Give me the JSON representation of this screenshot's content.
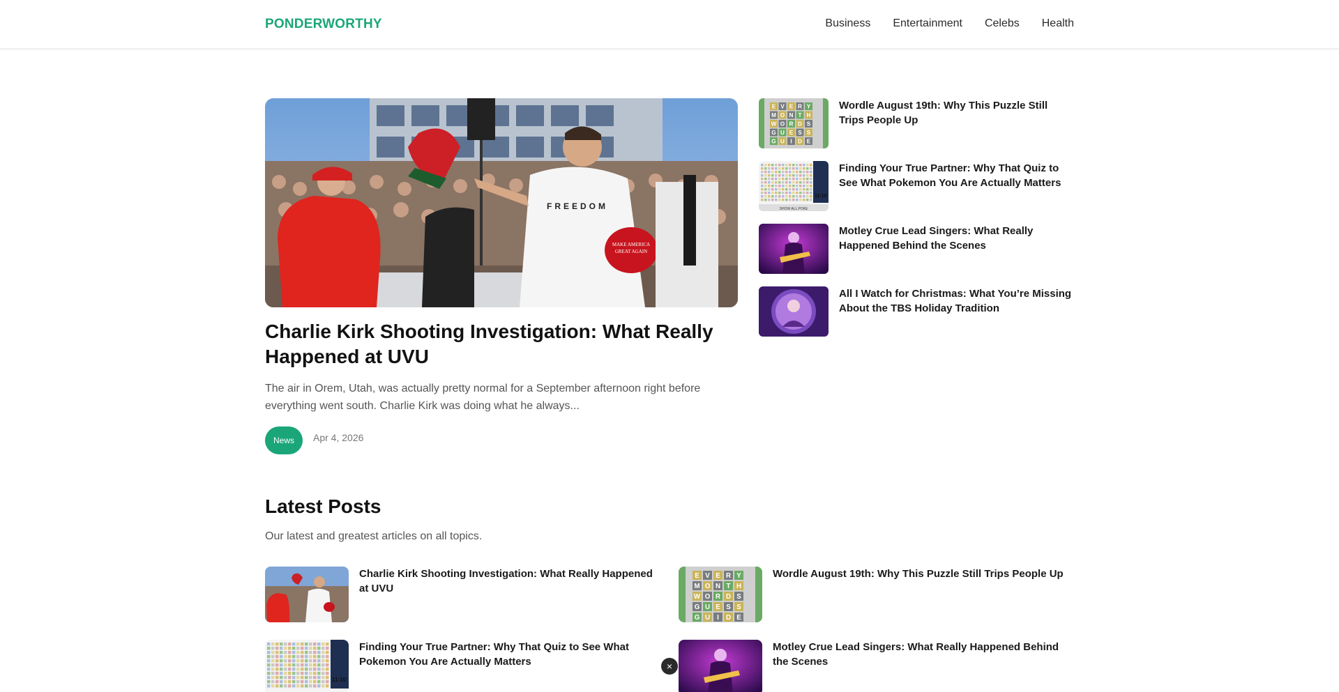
{
  "site": {
    "logo": "PONDERWORTHY",
    "accent": "#1aa679"
  },
  "nav": {
    "items": [
      "Business",
      "Entertainment",
      "Celebs",
      "Health"
    ]
  },
  "hero": {
    "title": "Charlie Kirk Shooting Investigation: What Really Happened at UVU",
    "excerpt": "The air in Orem, Utah, was actually pretty normal for a September afternoon right before everything went south. Charlie Kirk was doing what he always...",
    "category": "News",
    "date": "Apr 4, 2026",
    "image_icon": "rally-photo",
    "shirt_text": "FREEDOM",
    "hat_text": "MAKE AMERICA GREAT AGAIN"
  },
  "sidebar": {
    "items": [
      {
        "title": "Wordle August 19th: Why This Puzzle Still Trips People Up",
        "thumb": "wordle-grid"
      },
      {
        "title": "Finding Your True Partner: Why That Quiz to See What Pokemon You Are Actually Matters",
        "thumb": "pokemon-quiz-grid"
      },
      {
        "title": "Motley Crue Lead Singers: What Really Happened Behind the Scenes",
        "thumb": "concert-guitarist"
      },
      {
        "title": "All I Watch for Christmas: What You’re Missing About the TBS Holiday Tradition",
        "thumb": "purple-portrait"
      }
    ]
  },
  "latest": {
    "title": "Latest Posts",
    "subtitle": "Our latest and greatest articles on all topics.",
    "posts": [
      {
        "title": "Charlie Kirk Shooting Investigation: What Really Happened at UVU",
        "thumb": "rally-photo"
      },
      {
        "title": "Wordle August 19th: Why This Puzzle Still Trips People Up",
        "thumb": "wordle-grid"
      },
      {
        "title": "Finding Your True Partner: Why That Quiz to See What Pokemon You Are Actually Matters",
        "thumb": "pokemon-quiz-grid"
      },
      {
        "title": "Motley Crue Lead Singers: What Really Happened Behind the Scenes",
        "thumb": "concert-guitarist"
      }
    ]
  },
  "overlay": {
    "close_label": "×"
  },
  "thumb_text": {
    "wordle": [
      "EVERY",
      "MONTH",
      "WORDS",
      "GUESS",
      "GUIDE"
    ],
    "pokemon_clock": "11:10",
    "pokemon_footer": "SHOW ALL POKE"
  }
}
